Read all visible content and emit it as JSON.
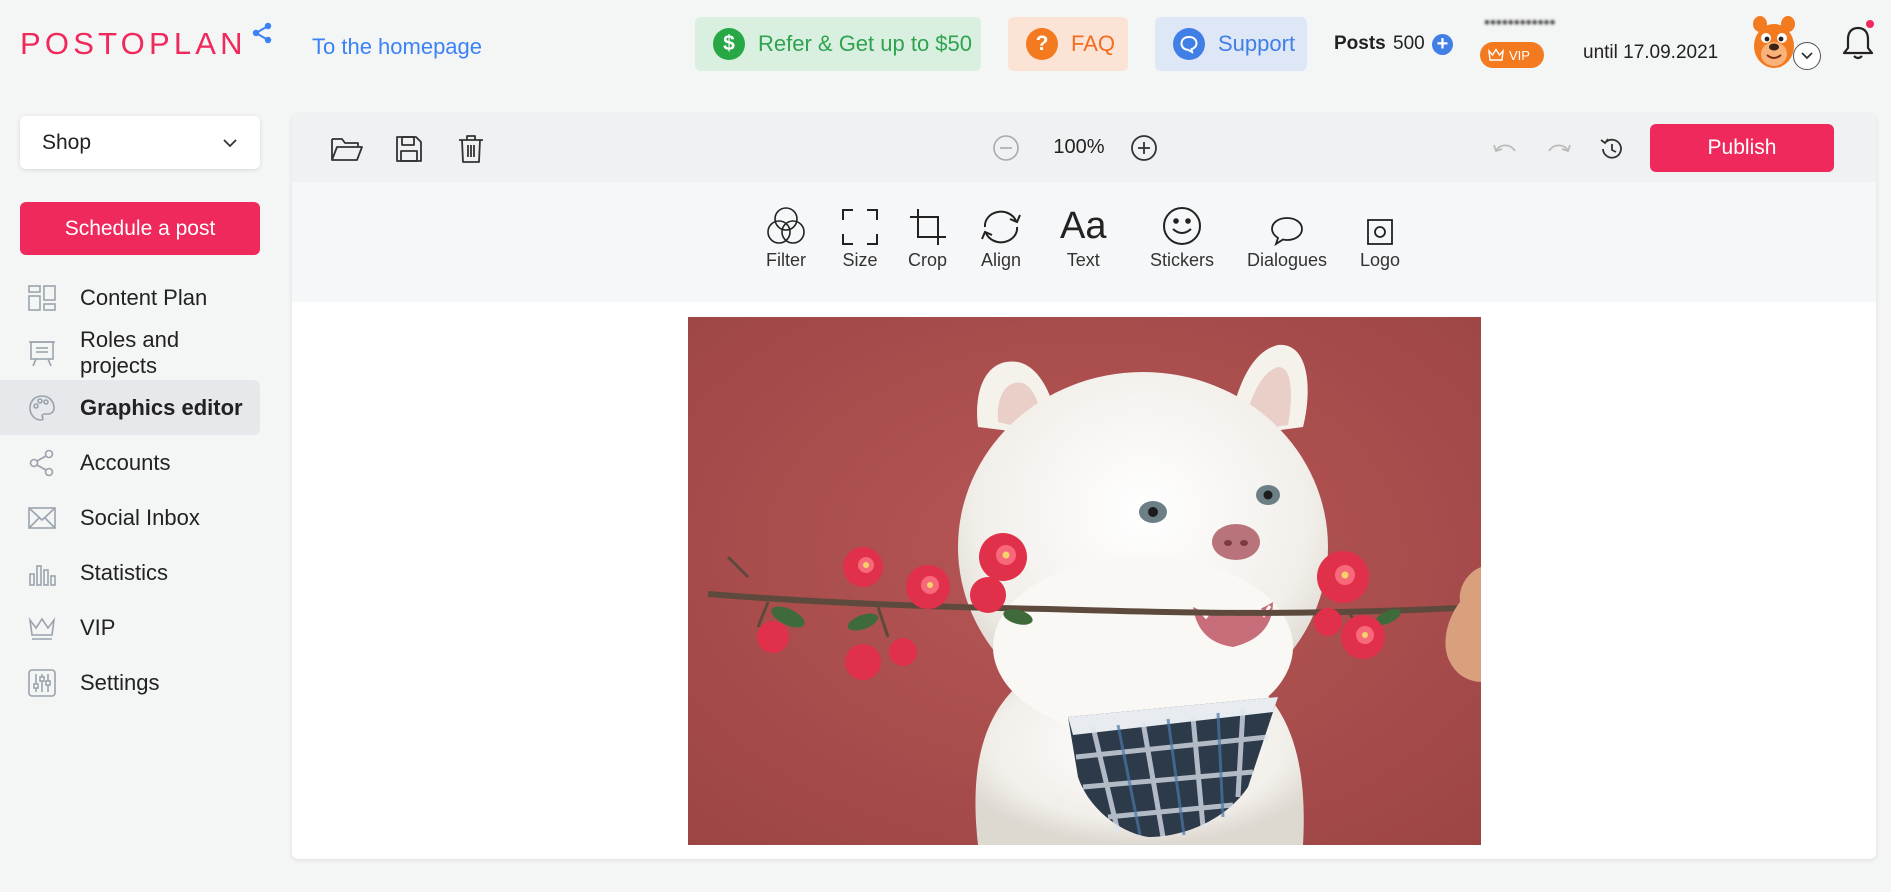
{
  "header": {
    "logo": "POSTOPLAN",
    "homepage_link": "To the homepage",
    "refer_label": "Refer & Get up to $50",
    "faq_label": "FAQ",
    "support_label": "Support",
    "posts_label": "Posts",
    "posts_count": "500",
    "username": "••••••••••••",
    "vip_label": "VIP",
    "until_label": "until 17.09.2021"
  },
  "sidebar": {
    "shop_selected": "Shop",
    "schedule_label": "Schedule a post",
    "items": [
      {
        "label": "Content Plan",
        "icon": "content-plan-icon"
      },
      {
        "label": "Roles and projects",
        "icon": "roles-icon"
      },
      {
        "label": "Graphics editor",
        "icon": "palette-icon",
        "active": true
      },
      {
        "label": "Accounts",
        "icon": "share-nodes-icon"
      },
      {
        "label": "Social Inbox",
        "icon": "envelope-icon"
      },
      {
        "label": "Statistics",
        "icon": "bar-chart-icon"
      },
      {
        "label": "VIP",
        "icon": "crown-icon"
      },
      {
        "label": "Settings",
        "icon": "sliders-icon"
      }
    ]
  },
  "editor": {
    "zoom": "100%",
    "publish_label": "Publish",
    "tools": [
      {
        "label": "Filter",
        "icon": "filter-icon"
      },
      {
        "label": "Size",
        "icon": "size-icon"
      },
      {
        "label": "Crop",
        "icon": "crop-icon"
      },
      {
        "label": "Align",
        "icon": "rotate-icon"
      },
      {
        "label": "Text",
        "icon": "text-icon"
      },
      {
        "label": "Stickers",
        "icon": "smiley-icon"
      },
      {
        "label": "Dialogues",
        "icon": "speech-bubble-icon"
      },
      {
        "label": "Logo",
        "icon": "logo-icon"
      }
    ]
  },
  "colors": {
    "brand_pink": "#f0295c",
    "link_blue": "#3b82f6",
    "refer_green": "#28a745",
    "faq_orange": "#f47a20",
    "support_blue": "#3f7fe6"
  }
}
